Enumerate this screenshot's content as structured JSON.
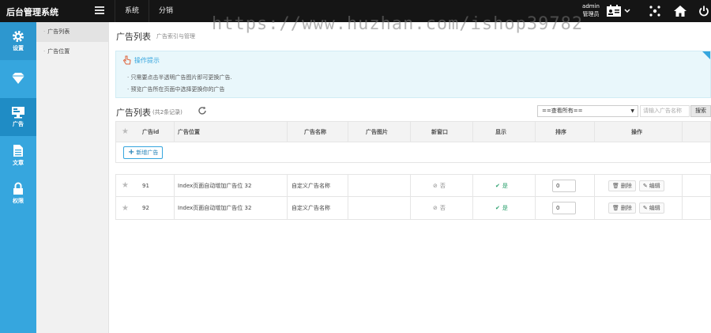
{
  "topbar": {
    "brand": "后台管理系统",
    "nav": [
      "系统",
      "分销"
    ],
    "watermark": "https://www.huzhan.com/ishop39782",
    "user_name": "admin",
    "user_role": "管理员"
  },
  "sidebar": {
    "items": [
      {
        "label": "设置",
        "icon": "gear-icon"
      },
      {
        "label": "",
        "icon": "diamond-icon"
      },
      {
        "label": "广告",
        "icon": "monitor-icon"
      },
      {
        "label": "文章",
        "icon": "document-icon"
      },
      {
        "label": "权限",
        "icon": "lock-icon"
      }
    ]
  },
  "subnav": {
    "items": [
      "广告列表",
      "广告位置"
    ]
  },
  "main": {
    "title": "广告列表",
    "subtitle": "广告索引与管理",
    "tips": {
      "title": "操作提示",
      "lines": [
        "只需要点击半透明广告图片即可更换广告.",
        "预览广告所在页面中选择更换你的广告"
      ]
    },
    "list_title": "广告列表",
    "list_count": "(共2条记录)",
    "filter_selected": "==查看所有==",
    "search_placeholder": "请输入广告名称",
    "search_button": "搜索",
    "add_button": "新增广告",
    "columns": [
      "广告id",
      "广告位置",
      "广告名称",
      "广告图片",
      "新窗口",
      "显示",
      "排序",
      "操作"
    ],
    "rows": [
      {
        "id": "91",
        "position": "Index页面自动增加广告位 32",
        "name": "自定义广告名称",
        "new_window": "否",
        "show": "是",
        "sort": "0",
        "delete": "删除",
        "edit": "编辑"
      },
      {
        "id": "92",
        "position": "Index页面自动增加广告位 32",
        "name": "自定义广告名称",
        "new_window": "否",
        "show": "是",
        "sort": "0",
        "delete": "删除",
        "edit": "编辑"
      }
    ]
  },
  "colors": {
    "sidebar": "#36a6de",
    "topbar": "#151515",
    "accent": "#36a6de",
    "success": "#2aa06d"
  }
}
